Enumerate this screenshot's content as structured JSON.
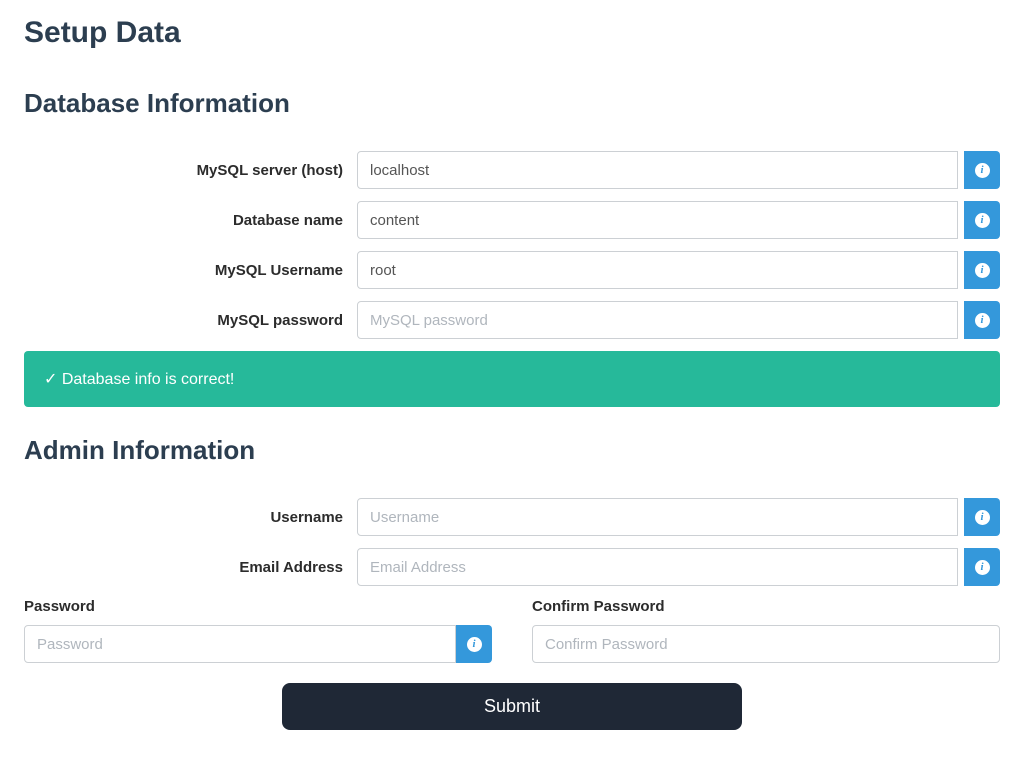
{
  "page_title": "Setup Data",
  "db_section": {
    "heading": "Database Information",
    "host_label": "MySQL server (host)",
    "host_value": "localhost",
    "dbname_label": "Database name",
    "dbname_value": "content",
    "dbuser_label": "MySQL Username",
    "dbuser_value": "root",
    "dbpass_label": "MySQL password",
    "dbpass_placeholder": "MySQL password",
    "success_message": "✓ Database info is correct!"
  },
  "admin_section": {
    "heading": "Admin Information",
    "username_label": "Username",
    "username_placeholder": "Username",
    "email_label": "Email Address",
    "email_placeholder": "Email Address",
    "password_label": "Password",
    "password_placeholder": "Password",
    "confirm_label": "Confirm Password",
    "confirm_placeholder": "Confirm Password"
  },
  "submit_label": "Submit",
  "info_glyph": "i"
}
